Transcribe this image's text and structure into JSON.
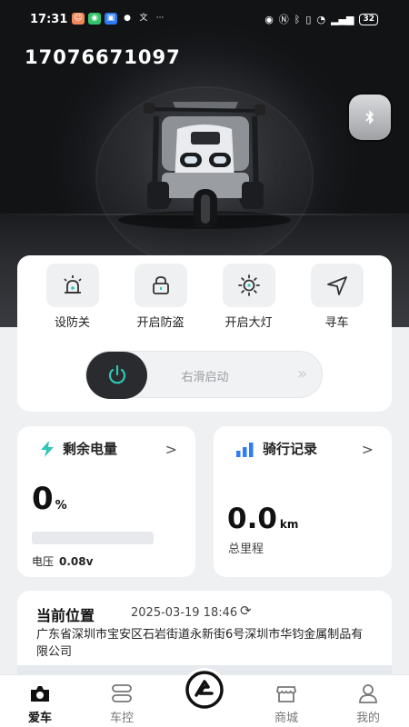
{
  "status_bar": {
    "time": "17:31",
    "battery_level": "32"
  },
  "header": {
    "phone_number": "17076671097"
  },
  "quick_actions": [
    {
      "label": "设防关",
      "icon": "alarm-siren-icon"
    },
    {
      "label": "开启防盗",
      "icon": "lock-icon"
    },
    {
      "label": "开启大灯",
      "icon": "sun-light-icon"
    },
    {
      "label": "寻车",
      "icon": "navigation-arrow-icon"
    }
  ],
  "slider": {
    "label": "右滑启动"
  },
  "battery_card": {
    "title": "剩余电量",
    "percent_value": "0",
    "percent_unit": "%",
    "level": 0,
    "voltage_label": "电压",
    "voltage_value": "0.08v"
  },
  "ride_card": {
    "title": "骑行记录",
    "mileage_value": "0.0",
    "mileage_unit": "km",
    "mileage_label": "总里程"
  },
  "location_card": {
    "title": "当前位置",
    "timestamp": "2025-03-19 18:46",
    "address": "广东省深圳市宝安区石岩街道永新街6号深圳市华钧金属制品有限公司"
  },
  "tabs": [
    {
      "label": "爱车",
      "icon": "camera-home-icon",
      "active": true
    },
    {
      "label": "车控",
      "icon": "controls-icon",
      "active": false
    },
    {
      "label": "",
      "icon": "brand-logo-icon",
      "active": false
    },
    {
      "label": "商城",
      "icon": "store-icon",
      "active": false
    },
    {
      "label": "我的",
      "icon": "person-icon",
      "active": false
    }
  ],
  "colors": {
    "accent": "#2fc7b8",
    "blue": "#2f7cf6",
    "dark": "#2a2b2e"
  }
}
